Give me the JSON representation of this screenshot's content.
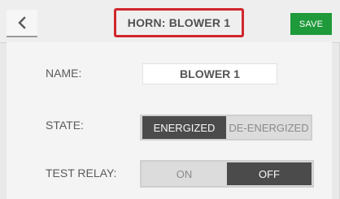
{
  "header": {
    "back_icon": "chevron-left-icon",
    "title": "HORN: BLOWER 1",
    "title_highlight_color": "#d0262d",
    "save_label": "SAVE",
    "save_color": "#1e9a3a"
  },
  "form": {
    "name": {
      "label": "NAME:",
      "value": "BLOWER 1"
    },
    "state": {
      "label": "STATE:",
      "options": [
        "ENERGIZED",
        "DE-ENERGIZED"
      ],
      "selected": "ENERGIZED"
    },
    "test_relay": {
      "label": "TEST RELAY:",
      "options": [
        "ON",
        "OFF"
      ],
      "selected": "OFF"
    }
  }
}
